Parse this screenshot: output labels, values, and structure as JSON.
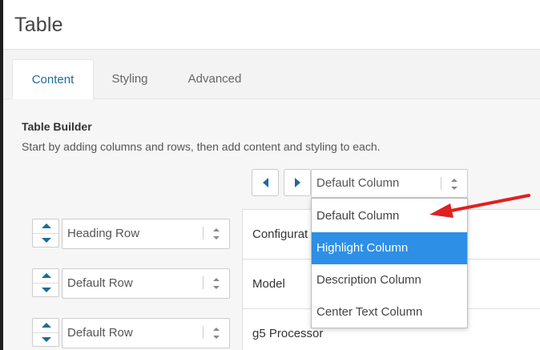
{
  "header": {
    "title": "Table"
  },
  "tabs": [
    {
      "label": "Content",
      "active": true
    },
    {
      "label": "Styling",
      "active": false
    },
    {
      "label": "Advanced",
      "active": false
    }
  ],
  "builder": {
    "title": "Table Builder",
    "description": "Start by adding columns and rows, then add content and styling to each."
  },
  "column_select": {
    "value": "Default Column",
    "options": [
      "Default Column",
      "Highlight Column",
      "Description Column",
      "Center Text Column"
    ],
    "highlighted_index": 1
  },
  "rows": [
    {
      "type": "Heading Row",
      "cell": "Configurat"
    },
    {
      "type": "Default Row",
      "cell": "Model"
    },
    {
      "type": "Default Row",
      "cell": "g5 Processor"
    }
  ],
  "colors": {
    "accent": "#1f6a9a",
    "highlight": "#2d8fe6",
    "annotation_arrow": "#e02020"
  },
  "icons": [
    "prev-column-icon",
    "next-column-icon",
    "updown-icon",
    "move-row-icon",
    "annotation-arrow-icon"
  ]
}
